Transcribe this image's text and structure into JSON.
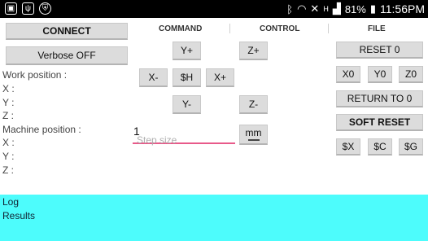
{
  "status": {
    "battery": "81%",
    "time": "11:56PM",
    "network": "H"
  },
  "left": {
    "connect": "CONNECT",
    "verbose": "Verbose OFF",
    "work_position": "Work position :",
    "machine_position": "Machine position :",
    "x": "X :",
    "y": "Y :",
    "z": "Z :"
  },
  "headers": {
    "command": "COMMAND",
    "control": "CONTROL",
    "file": "FILE"
  },
  "jog": {
    "yplus": "Y+",
    "zplus": "Z+",
    "xminus": "X-",
    "home": "$H",
    "xplus": "X+",
    "yminus": "Y-",
    "zminus": "Z-",
    "unit": "mm"
  },
  "step": {
    "value": "1",
    "placeholder": "Step size"
  },
  "right": {
    "reset": "RESET 0",
    "x0": "X0",
    "y0": "Y0",
    "z0": "Z0",
    "return": "RETURN TO 0",
    "soft_reset": "SOFT RESET",
    "sx": "$X",
    "sc": "$C",
    "sg": "$G"
  },
  "log": {
    "title": "Log",
    "results": "Results"
  }
}
